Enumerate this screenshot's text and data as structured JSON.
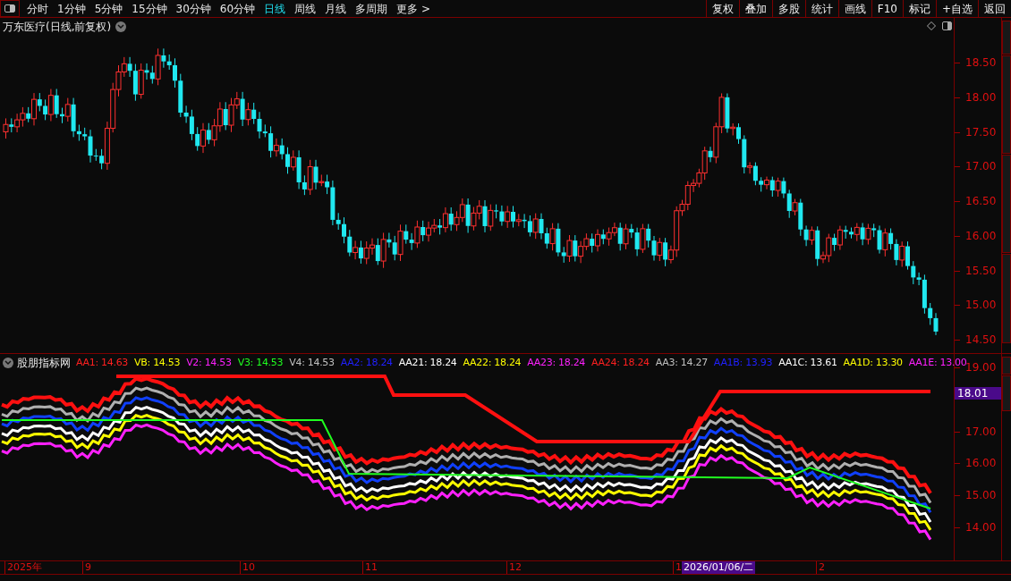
{
  "toolbar": {
    "periods": [
      {
        "label": "分时",
        "selected": false
      },
      {
        "label": "1分钟",
        "selected": false
      },
      {
        "label": "5分钟",
        "selected": false
      },
      {
        "label": "15分钟",
        "selected": false
      },
      {
        "label": "30分钟",
        "selected": false
      },
      {
        "label": "60分钟",
        "selected": false
      },
      {
        "label": "日线",
        "selected": true
      },
      {
        "label": "周线",
        "selected": false
      },
      {
        "label": "月线",
        "selected": false
      },
      {
        "label": "多周期",
        "selected": false
      },
      {
        "label": "更多 >",
        "selected": false
      }
    ],
    "buttons": [
      "复权",
      "叠加",
      "多股",
      "统计",
      "画线",
      "F10",
      "标记",
      "+自选",
      "返回"
    ]
  },
  "main_chart": {
    "title": "万东医疗(日线,前复权)",
    "price_axis": [
      "18.50",
      "18.00",
      "17.50",
      "17.00",
      "16.50",
      "16.00",
      "15.50",
      "15.00",
      "14.50"
    ]
  },
  "indicator": {
    "name": "股朋指标网",
    "values": [
      {
        "label": "AA1: 14.63",
        "color": "#ff2020"
      },
      {
        "label": "VB: 14.53",
        "color": "#ffff00"
      },
      {
        "label": "V2: 14.53",
        "color": "#ff20ff"
      },
      {
        "label": "V3: 14.53",
        "color": "#20ff20"
      },
      {
        "label": "V4: 14.53",
        "color": "#c0c0c0"
      },
      {
        "label": "AA2: 18.24",
        "color": "#2020ff"
      },
      {
        "label": "AA21: 18.24",
        "color": "#ffffff"
      },
      {
        "label": "AA22: 18.24",
        "color": "#ffff00"
      },
      {
        "label": "AA23: 18.24",
        "color": "#ff20ff"
      },
      {
        "label": "AA24: 18.24",
        "color": "#ff2020"
      },
      {
        "label": "AA3: 14.27",
        "color": "#c0c0c0"
      },
      {
        "label": "AA1B: 13.93",
        "color": "#2020ff"
      },
      {
        "label": "AA1C: 13.61",
        "color": "#ffffff"
      },
      {
        "label": "AA1D: 13.30",
        "color": "#ffff00"
      },
      {
        "label": "AA1E: 13.00",
        "color": "#ff20ff"
      }
    ],
    "price_axis": [
      "19.00",
      "17.00",
      "16.00",
      "15.00",
      "14.00"
    ],
    "current_value": "18.01"
  },
  "time_axis": {
    "labels": [
      "2025年",
      "9",
      "10",
      "11",
      "12",
      "1",
      "2"
    ],
    "cursor_date": "2026/01/06/二"
  }
}
